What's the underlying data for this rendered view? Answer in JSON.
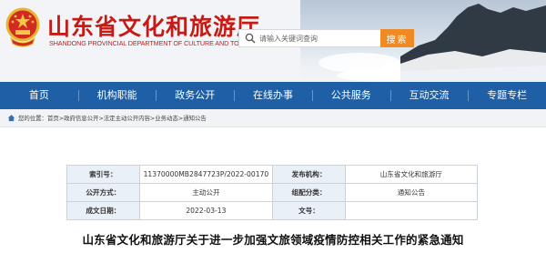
{
  "site": {
    "title_cn": "山东省文化和旅游厅",
    "title_en": "SHANDONG PROVINCIAL DEPARTMENT OF CULTURE AND TOURISM",
    "emblem_icon": "national-emblem-icon",
    "brand_color": "#c71a14"
  },
  "search": {
    "placeholder": "请输入关键词查询",
    "button_label": "搜索",
    "icon": "search-icon",
    "button_color": "#ef8a25"
  },
  "nav": {
    "color": "#1f5fa6",
    "items": [
      {
        "label": "首页"
      },
      {
        "label": "机构职能"
      },
      {
        "label": "政务公开"
      },
      {
        "label": "在线办事"
      },
      {
        "label": "公共服务"
      },
      {
        "label": "互动交流"
      },
      {
        "label": "专题专栏"
      }
    ]
  },
  "breadcrumb": {
    "icon": "home-icon",
    "prefix": "您的位置：",
    "items": [
      "首页",
      "政府信息公开",
      "法定主动公开内容",
      "业务动态",
      "通知公告"
    ],
    "separator": " > "
  },
  "meta": {
    "index_label": "索引号：",
    "index_value": "11370000MB2847723P/2022-00170",
    "publisher_label": "发布机构：",
    "publisher_value": "山东省文化和旅游厅",
    "mode_label": "公开方式：",
    "mode_value": "主动公开",
    "category_label": "组配分类：",
    "category_value": "通知公告",
    "date_label": "成文日期：",
    "date_value": "2022-03-13",
    "docno_label": "文号：",
    "docno_value": ""
  },
  "article": {
    "title": "山东省文化和旅游厅关于进一步加强文旅领域疫情防控相关工作的紧急通知"
  }
}
